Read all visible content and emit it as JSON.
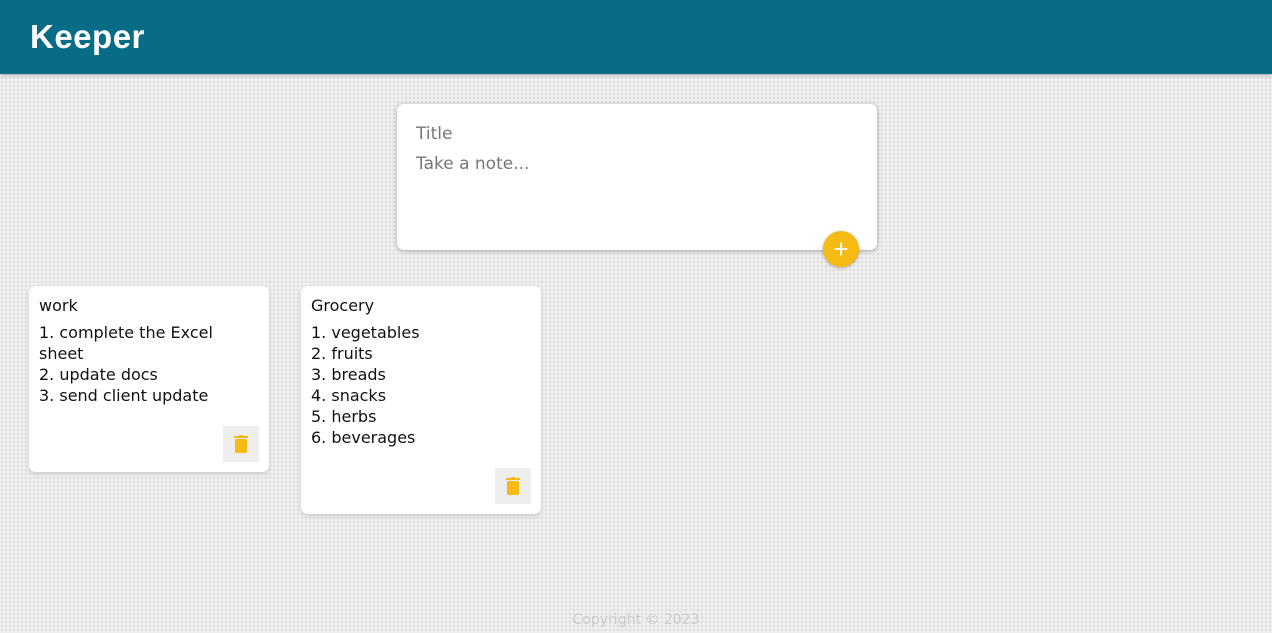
{
  "app": {
    "title": "Keeper"
  },
  "create": {
    "title_placeholder": "Title",
    "content_placeholder": "Take a note...",
    "add_label": "+"
  },
  "notes": [
    {
      "title": "work",
      "content": "1. complete the Excel sheet\n2. update docs\n3. send client update"
    },
    {
      "title": "Grocery",
      "content": "1. vegetables\n2. fruits\n3. breads\n4. snacks\n5. herbs\n6. beverages"
    }
  ],
  "footer": {
    "text": "Copyright © 2023"
  },
  "colors": {
    "header": "#086c86",
    "accent": "#f5ba13"
  }
}
